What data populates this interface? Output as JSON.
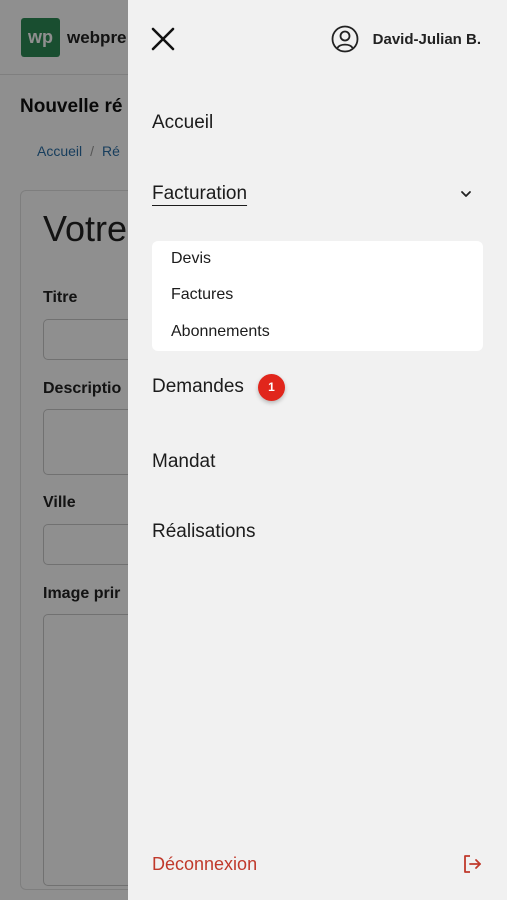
{
  "background": {
    "logo_mark": "wp",
    "logo_text": "webpre",
    "page_title": "Nouvelle ré",
    "breadcrumb": {
      "home": "Accueil",
      "separator": "/",
      "current": "Ré"
    },
    "card_heading": "Votre",
    "fields": {
      "title": "Titre",
      "description": "Descriptio",
      "city": "Ville",
      "main_image": "Image prir"
    }
  },
  "drawer": {
    "close_icon": "close-icon",
    "user": {
      "icon": "user-circle-icon",
      "name": "David-Julian B."
    },
    "nav": {
      "home": "Accueil",
      "billing": "Facturation",
      "billing_sub": [
        "Devis",
        "Factures",
        "Abonnements"
      ],
      "requests": "Demandes",
      "requests_badge": "1",
      "mandate": "Mandat",
      "projects": "Réalisations"
    },
    "logout": {
      "label": "Déconnexion",
      "icon": "logout-icon"
    }
  },
  "colors": {
    "brand": "#2e8b57",
    "danger": "#c0392b",
    "badge": "#e1261c",
    "link": "#2c6fa6"
  }
}
